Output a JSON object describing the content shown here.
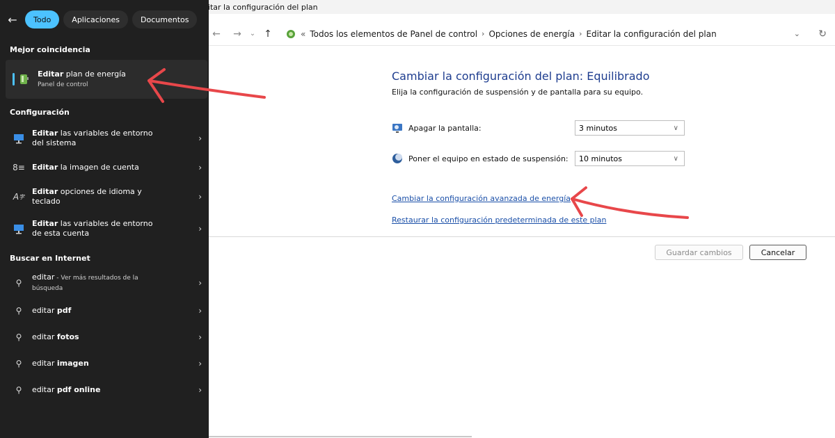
{
  "search_panel": {
    "tabs": [
      {
        "label": "Todo",
        "active": true
      },
      {
        "label": "Aplicaciones",
        "active": false
      },
      {
        "label": "Documentos",
        "active": false
      }
    ],
    "best_match_header": "Mejor coincidencia",
    "best_match": {
      "bold": "Editar",
      "rest": " plan de energía",
      "subtitle": "Panel de control",
      "icon": "power-plan-icon"
    },
    "settings_header": "Configuración",
    "settings": [
      {
        "bold": "Editar",
        "rest": " las variables de entorno del sistema",
        "icon": "monitor-icon"
      },
      {
        "bold": "Editar",
        "rest": " la imagen de cuenta",
        "icon": "account-icon"
      },
      {
        "bold": "Editar",
        "rest": " opciones de idioma y teclado",
        "icon": "language-icon"
      },
      {
        "bold": "Editar",
        "rest": " las variables de entorno de esta cuenta",
        "icon": "monitor-icon"
      }
    ],
    "web_header": "Buscar en Internet",
    "web": [
      {
        "normal": "editar",
        "bold": "",
        "hint": " - Ver más resultados de la búsqueda"
      },
      {
        "normal": "editar ",
        "bold": "pdf",
        "hint": ""
      },
      {
        "normal": "editar ",
        "bold": "fotos",
        "hint": ""
      },
      {
        "normal": "editar ",
        "bold": "imagen",
        "hint": ""
      },
      {
        "normal": "editar ",
        "bold": "pdf online",
        "hint": ""
      }
    ]
  },
  "control_panel": {
    "window_title": "Editar la configuración del plan",
    "breadcrumb": [
      "Todos los elementos de Panel de control",
      "Opciones de energía",
      "Editar la configuración del plan"
    ],
    "heading": "Cambiar la configuración del plan: Equilibrado",
    "subheading": "Elija la configuración de suspensión y de pantalla para su equipo.",
    "settings": [
      {
        "label": "Apagar la pantalla:",
        "value": "3 minutos",
        "icon": "display-icon"
      },
      {
        "label": "Poner el equipo en estado de suspensión:",
        "value": "10 minutos",
        "icon": "sleep-icon"
      }
    ],
    "link_advanced": "Cambiar la configuración avanzada de energía",
    "link_restore": "Restaurar la configuración predeterminada de este plan",
    "save_label": "Guardar cambios",
    "cancel_label": "Cancelar"
  },
  "colors": {
    "accent": "#4cc2ff",
    "annotation": "#e8474a",
    "heading": "#1e3d8f",
    "link": "#1a4fa8"
  }
}
